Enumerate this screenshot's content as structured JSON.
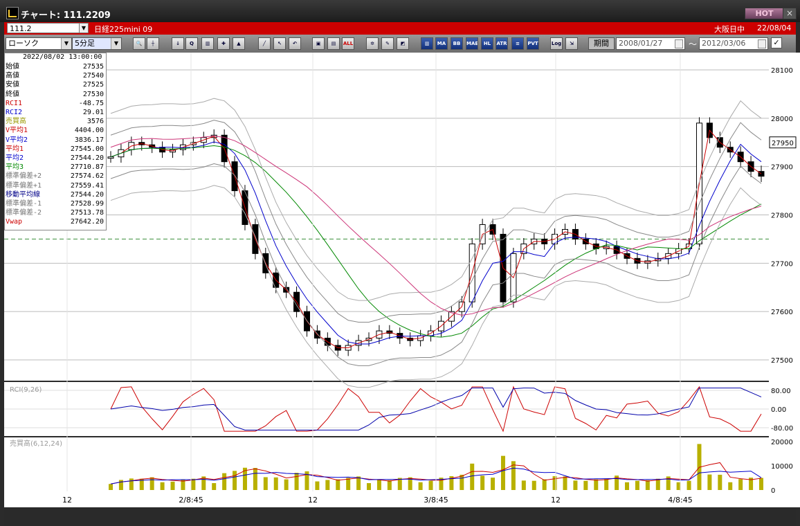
{
  "window": {
    "title": "チャート: 111.2209",
    "hot_label": "HOT",
    "close_label": "×"
  },
  "symbol_bar": {
    "code": "111.2",
    "name": "日経225mini 09",
    "session": "大阪日中",
    "date": "22/08/04"
  },
  "toolbar": {
    "chart_style": "ローソク",
    "interval": "5分足",
    "buttons": [
      "search",
      "cursor",
      "tool-a",
      "tool-b",
      "tool-c",
      "tool-d",
      "tool-e",
      "line",
      "arrow",
      "undo",
      "box-a",
      "box-b",
      "ALL",
      "settings",
      "pen",
      "color",
      "VOL",
      "MA",
      "BB",
      "MAE",
      "HL",
      "ATR",
      "ENV",
      "PVT",
      "Log",
      "export"
    ],
    "button_labels": {
      "all": "ALL",
      "ma": "MA",
      "bb": "BB",
      "mae": "MAE",
      "hl": "HL",
      "atr": "ATR",
      "pvt": "PVT",
      "log": "Log"
    },
    "period_label": "期間",
    "date_from": "2008/01/27",
    "tilde": "～",
    "date_to": "2012/03/06"
  },
  "info": {
    "datetime": "2022/08/02  13:00:00",
    "rows": [
      {
        "label": "始値",
        "value": "27535",
        "color": "#000000"
      },
      {
        "label": "高値",
        "value": "27540",
        "color": "#000000"
      },
      {
        "label": "安値",
        "value": "27525",
        "color": "#000000"
      },
      {
        "label": "終値",
        "value": "27530",
        "color": "#000000"
      },
      {
        "label": "RCI1",
        "value": "-48.75",
        "color": "#cc0000"
      },
      {
        "label": "RCI2",
        "value": "29.01",
        "color": "#0000cc"
      },
      {
        "label": "売買高",
        "value": "3576",
        "color": "#999900"
      },
      {
        "label": "V平均1",
        "value": "4404.00",
        "color": "#cc0000"
      },
      {
        "label": "V平均2",
        "value": "3836.17",
        "color": "#0000cc"
      },
      {
        "label": "平均1",
        "value": "27545.00",
        "color": "#cc0000"
      },
      {
        "label": "平均2",
        "value": "27544.20",
        "color": "#0000cc"
      },
      {
        "label": "平均3",
        "value": "27710.87",
        "color": "#008800"
      },
      {
        "label": "標準偏差+2",
        "value": "27574.62",
        "color": "#777777"
      },
      {
        "label": "標準偏差+1",
        "value": "27559.41",
        "color": "#777777"
      },
      {
        "label": "移動平均線",
        "value": "27544.20",
        "color": "#000088"
      },
      {
        "label": "標準偏差-1",
        "value": "27528.99",
        "color": "#777777"
      },
      {
        "label": "標準偏差-2",
        "value": "27513.78",
        "color": "#777777"
      },
      {
        "label": "Vwap",
        "value": "27642.20",
        "color": "#cc0000"
      }
    ]
  },
  "chart_data": {
    "type": "candlestick",
    "price_axis": {
      "ticks": [
        "28100",
        "28000",
        "27900",
        "27800",
        "27700",
        "27600",
        "27500"
      ],
      "current_price": "27950"
    },
    "time_axis": {
      "ticks": [
        "12",
        "2/8:45",
        "12",
        "3/8:45",
        "12",
        "4/8:45"
      ]
    },
    "rci_panel": {
      "title": "RCI(9,26)",
      "ticks": [
        "80.00",
        "0.00",
        "-80.00"
      ]
    },
    "volume_panel": {
      "title": "売買高(6,12,24)",
      "ticks": [
        "20000",
        "10000",
        "0"
      ]
    },
    "close_series": [
      27920,
      27935,
      27950,
      27945,
      27940,
      27930,
      27935,
      27945,
      27950,
      27960,
      27965,
      27910,
      27850,
      27780,
      27720,
      27680,
      27650,
      27640,
      27600,
      27560,
      27545,
      27530,
      27520,
      27530,
      27540,
      27545,
      27560,
      27555,
      27545,
      27540,
      27550,
      27560,
      27580,
      27600,
      27620,
      27740,
      27780,
      27760,
      27620,
      27720,
      27740,
      27750,
      27740,
      27760,
      27770,
      27750,
      27740,
      27730,
      27735,
      27720,
      27710,
      27700,
      27705,
      27710,
      27720,
      27730,
      27740,
      27990,
      27960,
      27940,
      27930,
      27910,
      27890,
      27880
    ]
  },
  "colors": {
    "bg": "#ffffff",
    "grid": "#bbbbbb",
    "candle": "#000000",
    "ma1": "#cc0000",
    "ma2": "#0000cc",
    "ma3": "#008800",
    "vwap": "#cc3377",
    "band": "#888888",
    "vol": "#b8b000",
    "rci1": "#cc0000",
    "rci2": "#0000aa"
  }
}
